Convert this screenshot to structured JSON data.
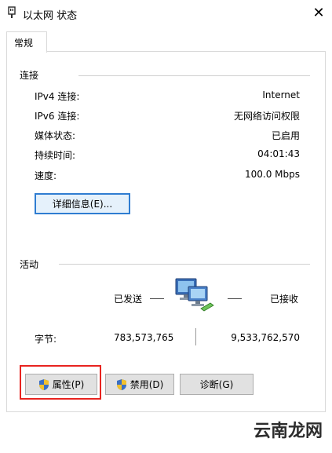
{
  "window": {
    "title": "以太网 状态",
    "close_glyph": "✕"
  },
  "tabs": [
    {
      "label": "常规"
    }
  ],
  "connection": {
    "section_label": "连接",
    "rows": [
      {
        "label": "IPv4 连接:",
        "value": "Internet"
      },
      {
        "label": "IPv6 连接:",
        "value": "无网络访问权限"
      },
      {
        "label": "媒体状态:",
        "value": "已启用"
      },
      {
        "label": "持续时间:",
        "value": "04:01:43"
      },
      {
        "label": "速度:",
        "value": "100.0 Mbps"
      }
    ],
    "details_button": "详细信息(E)..."
  },
  "activity": {
    "section_label": "活动",
    "sent_label": "已发送",
    "received_label": "已接收",
    "bytes_label": "字节:",
    "bytes_sent": "783,573,765",
    "bytes_received": "9,533,762,570",
    "icon": "network-computers-icon"
  },
  "buttons": {
    "properties": "属性(P)",
    "disable": "禁用(D)",
    "diagnose": "诊断(G)"
  },
  "watermark": {
    "text": "云南龙网"
  },
  "colors": {
    "accent": "#2f7dd1",
    "highlight": "#e8231f",
    "shield_blue": "#3b6fc4",
    "shield_yellow": "#f2c12e"
  }
}
